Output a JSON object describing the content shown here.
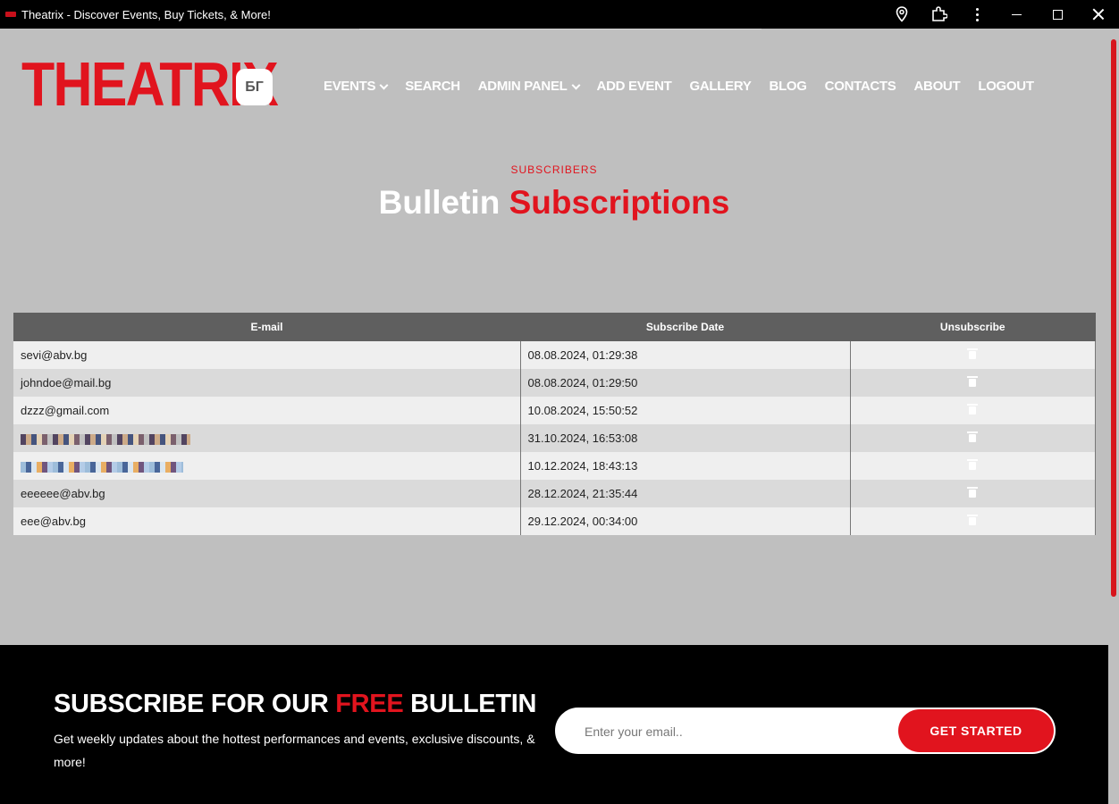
{
  "window": {
    "title": "Theatrix - Discover Events, Buy Tickets, & More!"
  },
  "header": {
    "logo_text": "THEATRIX",
    "lang_label": "БГ",
    "nav": [
      "EVENTS",
      "SEARCH",
      "ADMIN PANEL",
      "ADD EVENT",
      "GALLERY",
      "BLOG",
      "CONTACTS",
      "ABOUT",
      "LOGOUT"
    ]
  },
  "heading": {
    "kicker": "SUBSCRIBERS",
    "title_main": "Bulletin",
    "title_accent": "Subscriptions"
  },
  "table": {
    "columns": [
      "E-mail",
      "Subscribe Date",
      "Unsubscribe"
    ],
    "rows": [
      {
        "email": "sevi@abv.bg",
        "date": "08.08.2024, 01:29:38"
      },
      {
        "email": "johndoe@mail.bg",
        "date": "08.08.2024, 01:29:50"
      },
      {
        "email": "dzzz@gmail.com",
        "date": "10.08.2024, 15:50:52"
      },
      {
        "email": "",
        "date": "31.10.2024, 16:53:08"
      },
      {
        "email": "",
        "date": "10.12.2024, 18:43:13"
      },
      {
        "email": "eeeeee@abv.bg",
        "date": "28.12.2024, 21:35:44"
      },
      {
        "email": "eee@abv.bg",
        "date": "29.12.2024, 00:34:00"
      }
    ]
  },
  "footer": {
    "title_pre": "SUBSCRIBE FOR OUR",
    "title_accent": "FREE",
    "title_post": "BULLETIN",
    "description": "Get weekly updates about the hottest performances and events, exclusive discounts, & more!",
    "email_placeholder": "Enter your email..",
    "button_label": "GET STARTED"
  },
  "colors": {
    "brand_red": "#e1141e",
    "page_bg": "#bfbfbf",
    "table_header": "#5f5f5f"
  }
}
